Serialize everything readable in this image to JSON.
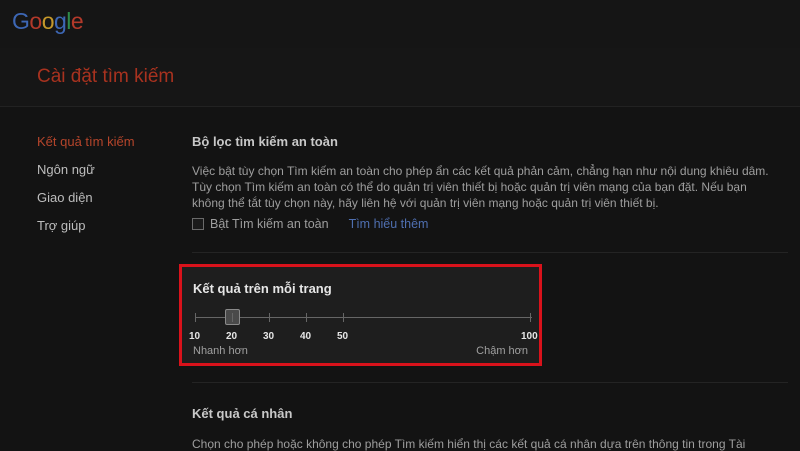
{
  "logo": {
    "letters": [
      {
        "ch": "G",
        "color": "#3d67b5"
      },
      {
        "ch": "o",
        "color": "#b3392a"
      },
      {
        "ch": "o",
        "color": "#c5982a"
      },
      {
        "ch": "g",
        "color": "#3d67b5"
      },
      {
        "ch": "l",
        "color": "#2f8a49"
      },
      {
        "ch": "e",
        "color": "#b3392a"
      }
    ]
  },
  "header": {
    "title": "Cài đặt tìm kiếm"
  },
  "sidebar": {
    "items": [
      {
        "label": "Kết quả tìm kiếm",
        "active": true
      },
      {
        "label": "Ngôn ngữ",
        "active": false
      },
      {
        "label": "Giao diện",
        "active": false
      },
      {
        "label": "Trợ giúp",
        "active": false
      }
    ]
  },
  "safe_search": {
    "title": "Bộ lọc tìm kiếm an toàn",
    "description": "Việc bật tùy chọn Tìm kiếm an toàn cho phép ẩn các kết quả phản cảm, chẳng hạn như nội dung khiêu dâm. Tùy chọn Tìm kiếm an toàn có thể do quản trị viên thiết bị hoặc quản trị viên mạng của bạn đặt. Nếu bạn không thể tắt tùy chọn này, hãy liên hệ với quản trị viên mạng hoặc quản trị viên thiết bị.",
    "checkbox_label": "Bật Tìm kiếm an toàn",
    "checked": false,
    "learn_more": "Tìm hiểu thêm"
  },
  "results_per_page": {
    "title": "Kết quả trên mỗi trang",
    "options": [
      "10",
      "20",
      "30",
      "40",
      "50",
      "100"
    ],
    "selected": "20",
    "left_label": "Nhanh hơn",
    "right_label": "Chậm hơn",
    "highlight_color": "#d9121b"
  },
  "personal_results": {
    "title": "Kết quả cá nhân",
    "description": "Chọn cho phép hoặc không cho phép Tìm kiếm hiển thị các kết quả cá nhân dựa trên thông tin trong Tài"
  }
}
